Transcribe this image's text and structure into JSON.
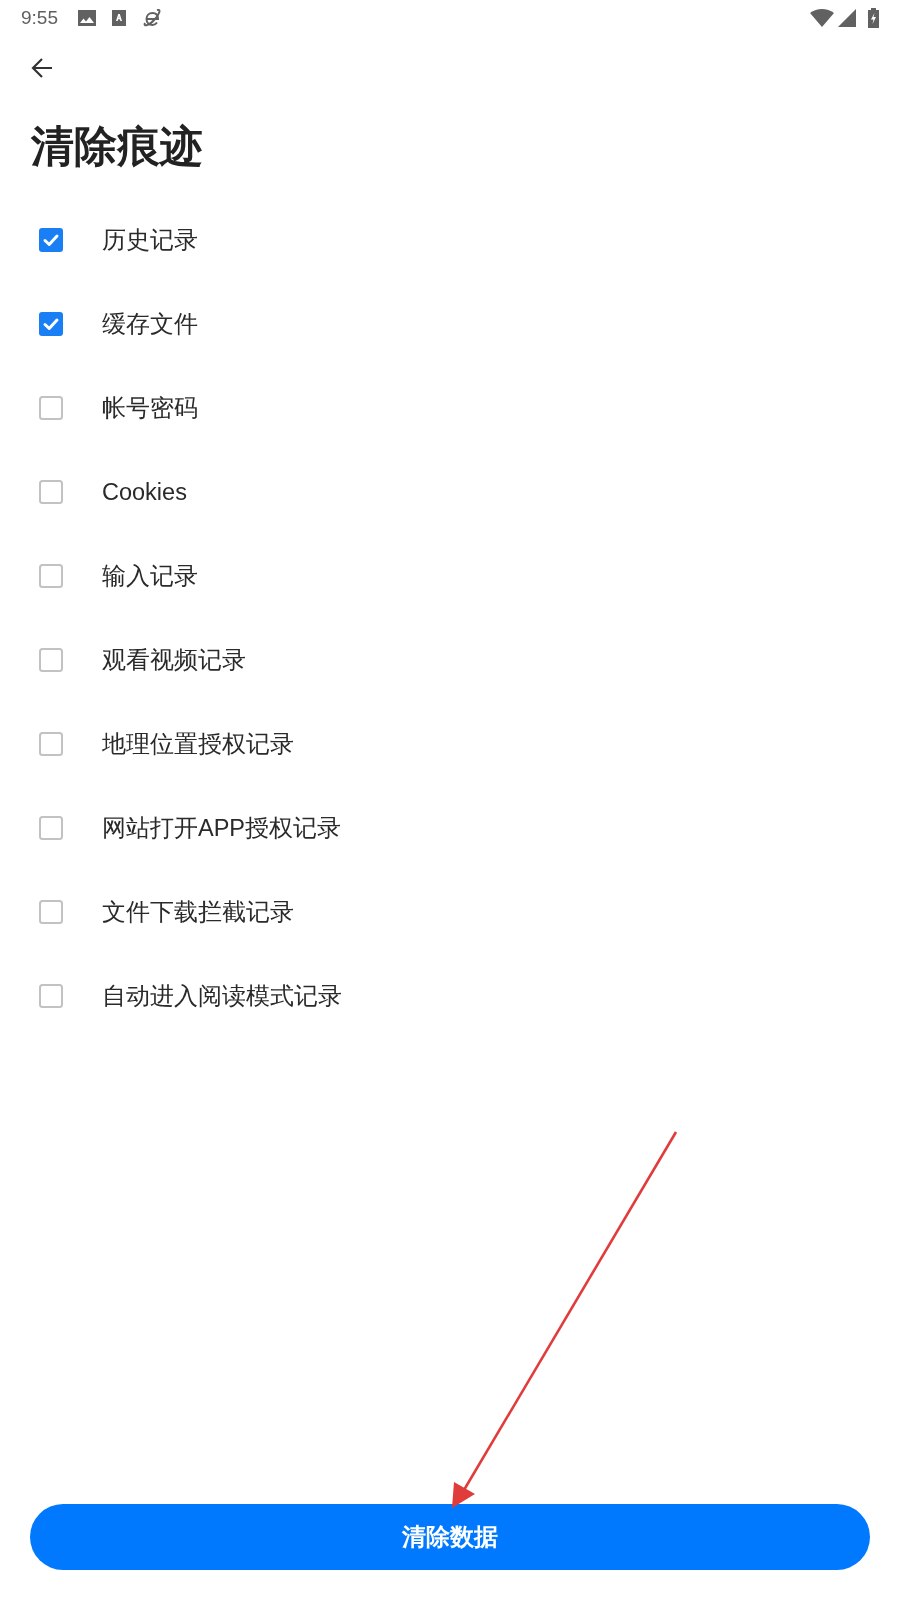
{
  "status_bar": {
    "time": "9:55"
  },
  "header": {
    "title": "清除痕迹"
  },
  "options": [
    {
      "label": "历史记录",
      "checked": true
    },
    {
      "label": "缓存文件",
      "checked": true
    },
    {
      "label": "帐号密码",
      "checked": false
    },
    {
      "label": "Cookies",
      "checked": false
    },
    {
      "label": "输入记录",
      "checked": false
    },
    {
      "label": "观看视频记录",
      "checked": false
    },
    {
      "label": "地理位置授权记录",
      "checked": false
    },
    {
      "label": "网站打开APP授权记录",
      "checked": false
    },
    {
      "label": "文件下载拦截记录",
      "checked": false
    },
    {
      "label": "自动进入阅读模式记录",
      "checked": false
    }
  ],
  "clear_button": {
    "label": "清除数据"
  }
}
